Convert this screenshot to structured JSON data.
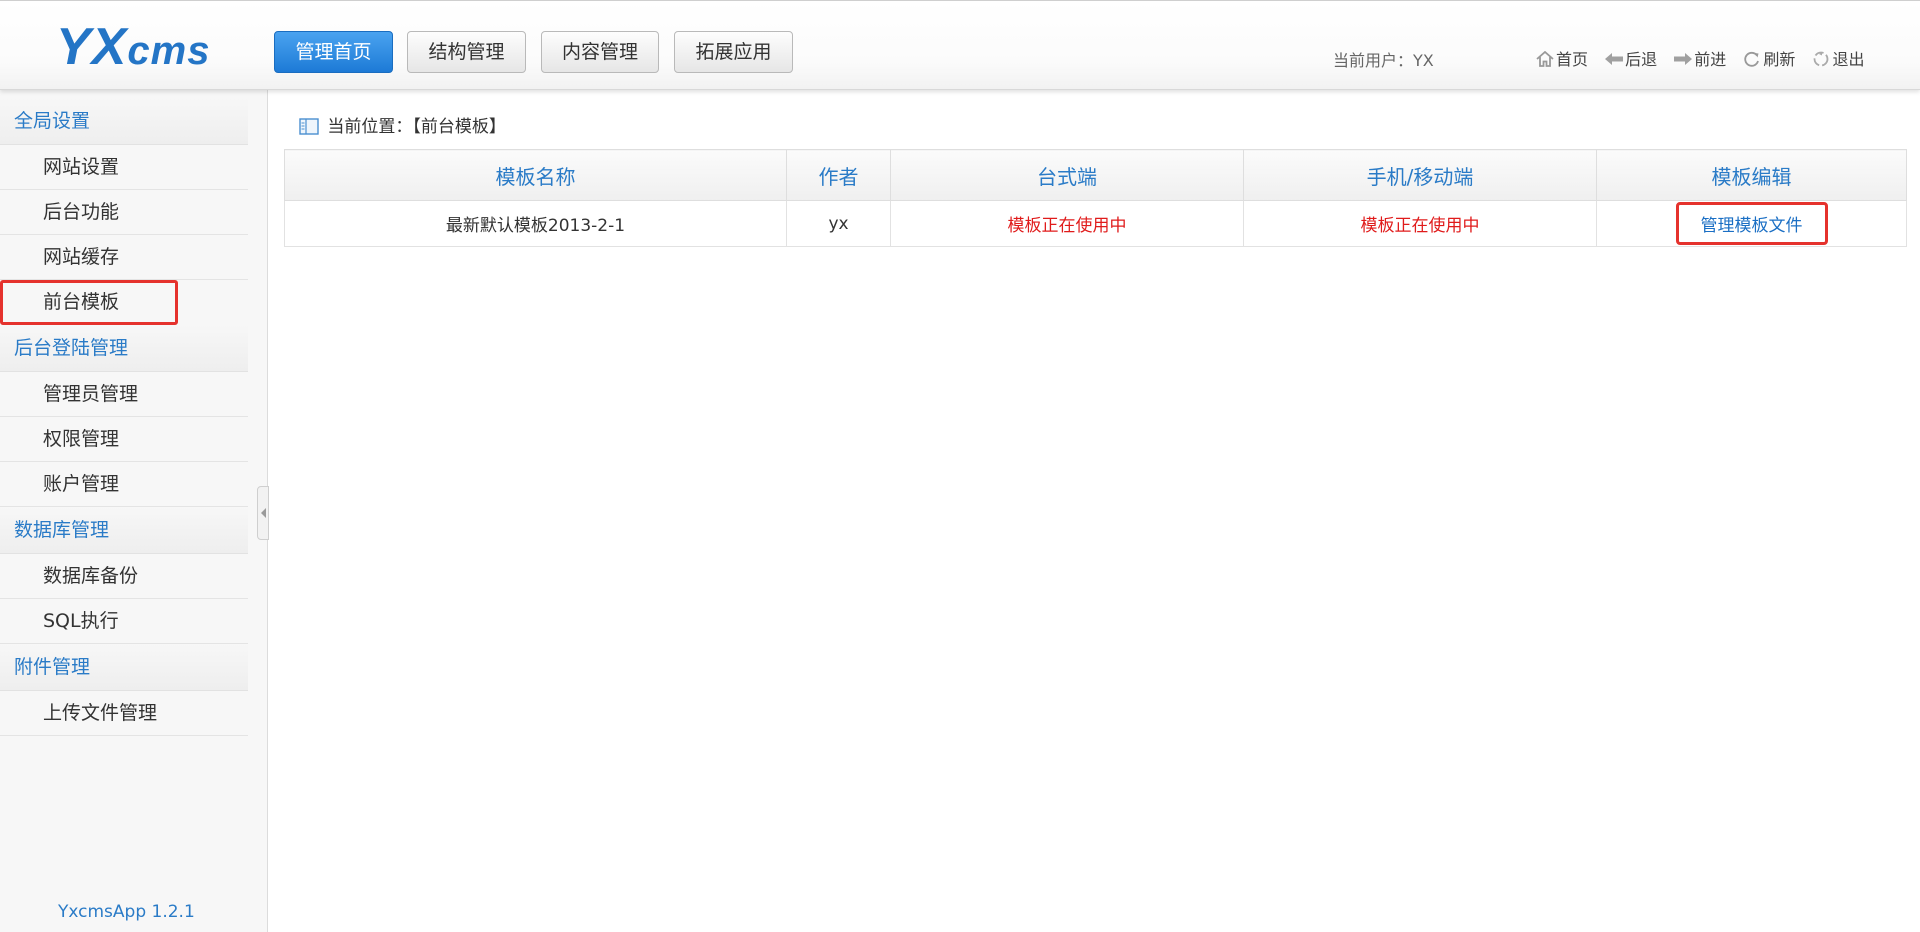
{
  "header": {
    "logo": {
      "big": "YX",
      "small": "cms"
    },
    "nav": [
      {
        "label": "管理首页",
        "active": true
      },
      {
        "label": "结构管理",
        "active": false
      },
      {
        "label": "内容管理",
        "active": false
      },
      {
        "label": "拓展应用",
        "active": false
      }
    ],
    "current_user_label": "当前用户：YX",
    "links": [
      {
        "label": "首页",
        "icon": "home-icon"
      },
      {
        "label": "后退",
        "icon": "back-arrow-icon"
      },
      {
        "label": "前进",
        "icon": "forward-arrow-icon"
      },
      {
        "label": "刷新",
        "icon": "refresh-icon"
      },
      {
        "label": "退出",
        "icon": "logout-icon"
      }
    ]
  },
  "sidebar": {
    "groups": [
      {
        "title": "全局设置",
        "items": [
          "网站设置",
          "后台功能",
          "网站缓存",
          "前台模板"
        ]
      },
      {
        "title": "后台登陆管理",
        "items": [
          "管理员管理",
          "权限管理",
          "账户管理"
        ]
      },
      {
        "title": "数据库管理",
        "items": [
          "数据库备份",
          "SQL执行"
        ]
      },
      {
        "title": "附件管理",
        "items": [
          "上传文件管理"
        ]
      }
    ],
    "selected_item": "前台模板",
    "version": "YxcmsApp 1.2.1"
  },
  "main": {
    "breadcrumb": "当前位置：【前台模板】",
    "table": {
      "headers": [
        "模板名称",
        "作者",
        "台式端",
        "手机/移动端",
        "模板编辑"
      ],
      "rows": [
        {
          "name": "最新默认模板2013-2-1",
          "author": "yx",
          "desktop_status": "模板正在使用中",
          "mobile_status": "模板正在使用中",
          "edit_link": "管理模板文件"
        }
      ]
    }
  },
  "colors": {
    "accent": "#2a7bc7",
    "active_nav": "#1d7ad6",
    "status_red": "#e01b1b",
    "highlight_box": "#e5322d"
  }
}
